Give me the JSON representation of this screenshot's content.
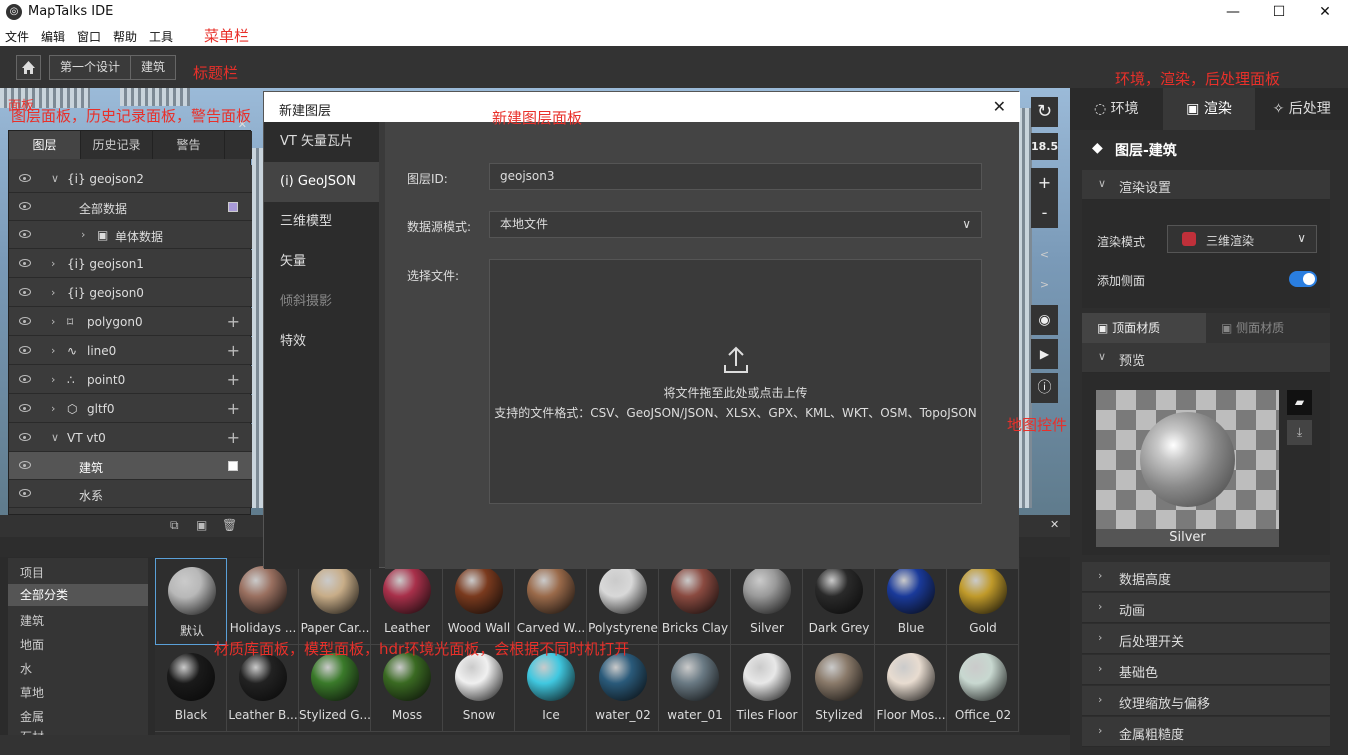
{
  "app": {
    "title": "MapTalks IDE",
    "icon": "maptalks-logo-icon"
  },
  "window": {
    "minimize": "—",
    "maximize": "☐",
    "close": "✕"
  },
  "menu": {
    "items": [
      "文件",
      "编辑",
      "窗口",
      "帮助",
      "工具"
    ]
  },
  "annotations": {
    "menu": "菜单栏",
    "titlebar": "标题栏",
    "env_panel": "环境，渲染，后处理面板",
    "layer_panel": "图层面板，历史记录面板，警告面板",
    "new_layer": "新建图层面板",
    "map_controls": "地图控件",
    "material": "材质库面板，模型面板，hdr环境光面板，会根据不同时机打开",
    "top_left": "面板"
  },
  "breadcrumb": [
    "第一个设计",
    "建筑"
  ],
  "left_panel": {
    "tabs": [
      "图层",
      "历史记录",
      "警告"
    ],
    "rows": [
      {
        "label": "{i} geojson2",
        "expanded": true
      },
      {
        "label": "全部数据",
        "swatch": "#a89ad8"
      },
      {
        "label": "单体数据"
      },
      {
        "label": "{i} geojson1"
      },
      {
        "label": "{i} geojson0"
      },
      {
        "label": "polygon0"
      },
      {
        "label": "line0"
      },
      {
        "label": "point0"
      },
      {
        "label": "gltf0"
      },
      {
        "label": "VT  vt0"
      },
      {
        "label": "建筑",
        "swatch": "#ffffff"
      },
      {
        "label": "水系"
      }
    ]
  },
  "map_controls": {
    "zoom_level": "18.5",
    "zoom_in": "+",
    "zoom_out": "-",
    "prev": "<",
    "next": ">"
  },
  "modal": {
    "title": "新建图层",
    "close": "✕",
    "side": [
      "VT 矢量瓦片",
      "(i) GeoJSON",
      "三维模型",
      "矢量",
      "倾斜摄影",
      "特效"
    ],
    "layer_id_label": "图层ID:",
    "layer_id_value": "geojson3",
    "source_label": "数据源模式:",
    "source_value": "本地文件",
    "file_label": "选择文件:",
    "drop_text": "将文件拖至此处或点击上传",
    "formats_text": "支持的文件格式：CSV、GeoJSON/JSON、XLSX、GPX、KML、WKT、OSM、TopoJSON"
  },
  "right_panel": {
    "tabs": [
      "环境",
      "渲染",
      "后处理"
    ],
    "layer_title": "图层-建筑",
    "render_settings": "渲染设置",
    "render_mode_label": "渲染模式",
    "render_mode_value": "三维渲染",
    "side_label": "添加侧面",
    "side_enabled": true,
    "mat_tabs": [
      "顶面材质",
      "侧面材质"
    ],
    "preview": "预览",
    "preview_name": "Silver",
    "sections": [
      "数据高度",
      "动画",
      "后处理开关",
      "基础色",
      "纹理缩放与偏移",
      "金属粗糙度"
    ]
  },
  "categories": [
    "项目",
    "全部分类",
    "建筑",
    "地面",
    "水",
    "草地",
    "金属",
    "石材"
  ],
  "materials": [
    {
      "name": "默认",
      "color": "#b8b8b8"
    },
    {
      "name": "Holidays ...",
      "color": "#9a7060"
    },
    {
      "name": "Paper Car...",
      "color": "#c8ad88"
    },
    {
      "name": "Leather",
      "color": "#a8304a"
    },
    {
      "name": "Wood Wall",
      "color": "#7a3a1e"
    },
    {
      "name": "Carved W...",
      "color": "#9a6a4a"
    },
    {
      "name": "Polystyrene",
      "color": "#d8d8d8"
    },
    {
      "name": "Bricks Clay",
      "color": "#8a4a40"
    },
    {
      "name": "Silver",
      "color": "#9a9a9a"
    },
    {
      "name": "Dark Grey",
      "color": "#2a2a2a"
    },
    {
      "name": "Blue",
      "color": "#1a3a9a"
    },
    {
      "name": "Gold",
      "color": "#c09a2a"
    },
    {
      "name": "Black",
      "color": "#1a1a1a"
    },
    {
      "name": "Leather B...",
      "color": "#222222"
    },
    {
      "name": "Stylized G...",
      "color": "#3a7a2a"
    },
    {
      "name": "Moss",
      "color": "#3a6a22"
    },
    {
      "name": "Snow",
      "color": "#f0f0f0"
    },
    {
      "name": "Ice",
      "color": "#40c8e0"
    },
    {
      "name": "water_02",
      "color": "#2a5a7a"
    },
    {
      "name": "water_01",
      "color": "#6a7a84"
    },
    {
      "name": "Tiles Floor",
      "color": "#e8e8e8"
    },
    {
      "name": "Stylized",
      "color": "#8a7a6a"
    },
    {
      "name": "Floor Mos...",
      "color": "#e8dcd0"
    },
    {
      "name": "Office_02",
      "color": "#c8d8d0"
    }
  ]
}
